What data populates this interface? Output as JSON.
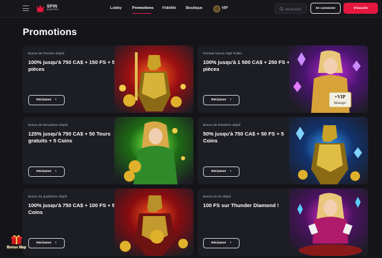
{
  "header": {
    "logo_line1": "SPIN",
    "logo_line2": "EMPIRE",
    "nav": [
      {
        "label": "Lobby"
      },
      {
        "label": "Promotions"
      },
      {
        "label": "Fidélité"
      },
      {
        "label": "Boutique"
      },
      {
        "label": "VIP"
      }
    ],
    "search_placeholder": "Rechercher",
    "login_label": "Se connecter",
    "signup_label": "S'inscrire"
  },
  "page": {
    "title": "Promotions"
  },
  "promos": [
    {
      "label": "Bonus de Premier Dépôt",
      "title": "100% jusqu'à 750 CA$ + 150 FS + 5 pièces",
      "cta": "Réclamer",
      "art": "golden-knight-art"
    },
    {
      "label": "Premier bonus High Roller",
      "title": "100% jusqu'à 1 500 CA$ + 250 FS + 30 pièces",
      "cta": "Réclamer",
      "art": "vip-manager-art",
      "art_badge_line1": "+VIP",
      "art_badge_line2": "Manager"
    },
    {
      "label": "Bonus de Deuxième Dépôt",
      "title": "125% jusqu'à 750 CA$ + 50 Tours gratuits + 5 Coins",
      "cta": "Réclamer",
      "art": "green-queen-art"
    },
    {
      "label": "Bonus de troisième dépôt",
      "title": "50% jusqu'à 750 CA$ + 50 FS + 5 Coins",
      "cta": "Réclamer",
      "art": "blue-knight-art"
    },
    {
      "label": "Bonus du quatrième dépôt",
      "title": "100% jusqu'à 750 CA$ + 100 FS + 5 Coins",
      "cta": "Réclamer",
      "art": "red-knight-art"
    },
    {
      "label": "Bonus du 5e dépôt",
      "title": "100 FS sur Thunder Diamond !",
      "cta": "Réclamer",
      "art": "card-queen-art"
    }
  ],
  "bonus_map": {
    "label": "Bonus Map"
  },
  "colors": {
    "accent": "#e5173f",
    "background": "#141419",
    "card": "#1d1d24"
  }
}
